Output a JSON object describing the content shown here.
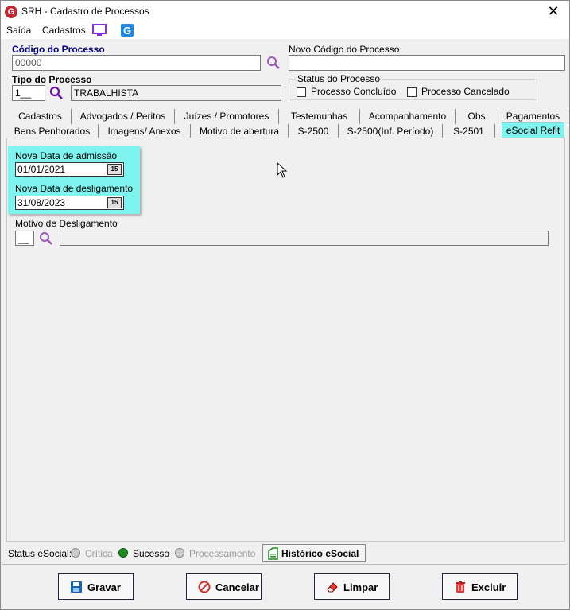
{
  "window": {
    "title": "SRH - Cadastro de Processos",
    "close": "✕"
  },
  "menu": {
    "saida": "Saída",
    "cadastros": "Cadastros"
  },
  "form": {
    "codigo_label": "Código do Processo",
    "codigo_value": "00000",
    "novo_codigo_label": "Novo Código do Processo",
    "novo_codigo_value": "",
    "tipo_label": "Tipo do Processo",
    "tipo_code": "1__",
    "tipo_desc": "TRABALHISTA",
    "status_label": "Status do Processo",
    "concluido_label": "Processo Concluído",
    "cancelado_label": "Processo Cancelado"
  },
  "tabs_row1": [
    "Cadastros",
    "Advogados / Peritos",
    "Juízes / Promotores",
    "Testemunhas",
    "Acompanhamento",
    "Obs",
    "Pagamentos"
  ],
  "tabs_row2": [
    "Bens Penhorados",
    "Imagens/ Anexos",
    "Motivo de abertura",
    "S-2500",
    "S-2500(Inf. Período)",
    "S-2501",
    "eSocial Refit"
  ],
  "refit": {
    "admissao_label": "Nova Data de admissão",
    "admissao_value": "01/01/2021",
    "desligamento_label": "Nova Data de desligamento",
    "desligamento_value": "31/08/2023",
    "motivo_label": "Motivo de Desligamento",
    "motivo_code": "__",
    "motivo_desc": "",
    "cal_icon": "15"
  },
  "status": {
    "label": "Status eSocial:",
    "critica": "Crítica",
    "sucesso": "Sucesso",
    "processamento": "Processamento",
    "historico": "Histórico eSocial"
  },
  "buttons": {
    "gravar": "Gravar",
    "cancelar": "Cancelar",
    "limpar": "Limpar",
    "excluir": "Excluir"
  },
  "colors": {
    "accent_tab": "#7ff3ee",
    "label_blue": "#000080",
    "search_purple": "#9b59b6",
    "success_green": "#1e8c1e"
  }
}
